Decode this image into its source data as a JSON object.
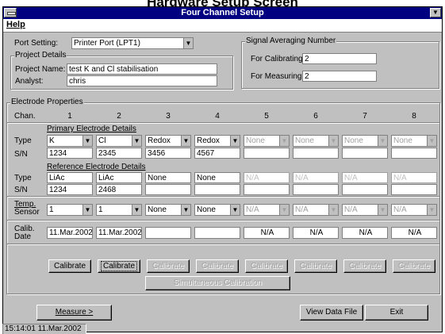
{
  "page_caption": "Hardware Setup Screen",
  "window": {
    "title": "Four Channel Setup"
  },
  "menu": {
    "help_label": "Help"
  },
  "port": {
    "label": "Port Setting:",
    "value": "Printer Port (LPT1)"
  },
  "project": {
    "group_label": "Project Details",
    "name_label": "Project Name:",
    "name_value": "test K and Cl stabilisation",
    "analyst_label": "Analyst:",
    "analyst_value": "chris"
  },
  "averaging": {
    "group_label": "Signal Averaging Number",
    "calibrating_label": "For Calibrating:",
    "calibrating_value": "2",
    "measuring_label": "For Measuring:",
    "measuring_value": "2"
  },
  "electrode": {
    "group_label": "Electrode Properties",
    "chan_label": "Chan.",
    "channels": [
      "1",
      "2",
      "3",
      "4",
      "5",
      "6",
      "7",
      "8"
    ],
    "primary_label": "Primary Electrode Details",
    "type_label": "Type",
    "sn_label": "S/N",
    "primary_types": [
      "K",
      "Cl",
      "Redox",
      "Redox",
      "None",
      "None",
      "None",
      "None"
    ],
    "primary_sn": [
      "1234",
      "2345",
      "3456",
      "4567",
      "",
      "",
      "",
      ""
    ],
    "reference_label": "Reference Electrode Details",
    "reference_types": [
      "LiAc",
      "LiAc",
      "None",
      "None",
      "N/A",
      "N/A",
      "N/A",
      "N/A"
    ],
    "reference_sn": [
      "1234",
      "2468",
      "",
      "",
      "",
      "",
      "",
      ""
    ],
    "temp_label_1": "Temp.",
    "temp_label_2": "Sensor",
    "temp_values": [
      "1",
      "1",
      "None",
      "None",
      "N/A",
      "N/A",
      "N/A",
      "N/A"
    ],
    "calib_label_1": "Calib.",
    "calib_label_2": "Date",
    "calib_dates": [
      "11.Mar.2002",
      "11.Mar.2002",
      "",
      "",
      "N/A",
      "N/A",
      "N/A",
      "N/A"
    ],
    "calibrate_label": "Calibrate",
    "simultaneous_label": "Simultaneous Calibration"
  },
  "footer": {
    "measure_label": "Measure >",
    "view_data_label": "View Data File",
    "exit_label": "Exit"
  },
  "status": {
    "text": "15:14:01 11.Mar.2002"
  },
  "icons": {
    "dropdown": "chevron-down-icon",
    "system_menu": "window-menu-icon",
    "minimize": "minimize-icon"
  }
}
